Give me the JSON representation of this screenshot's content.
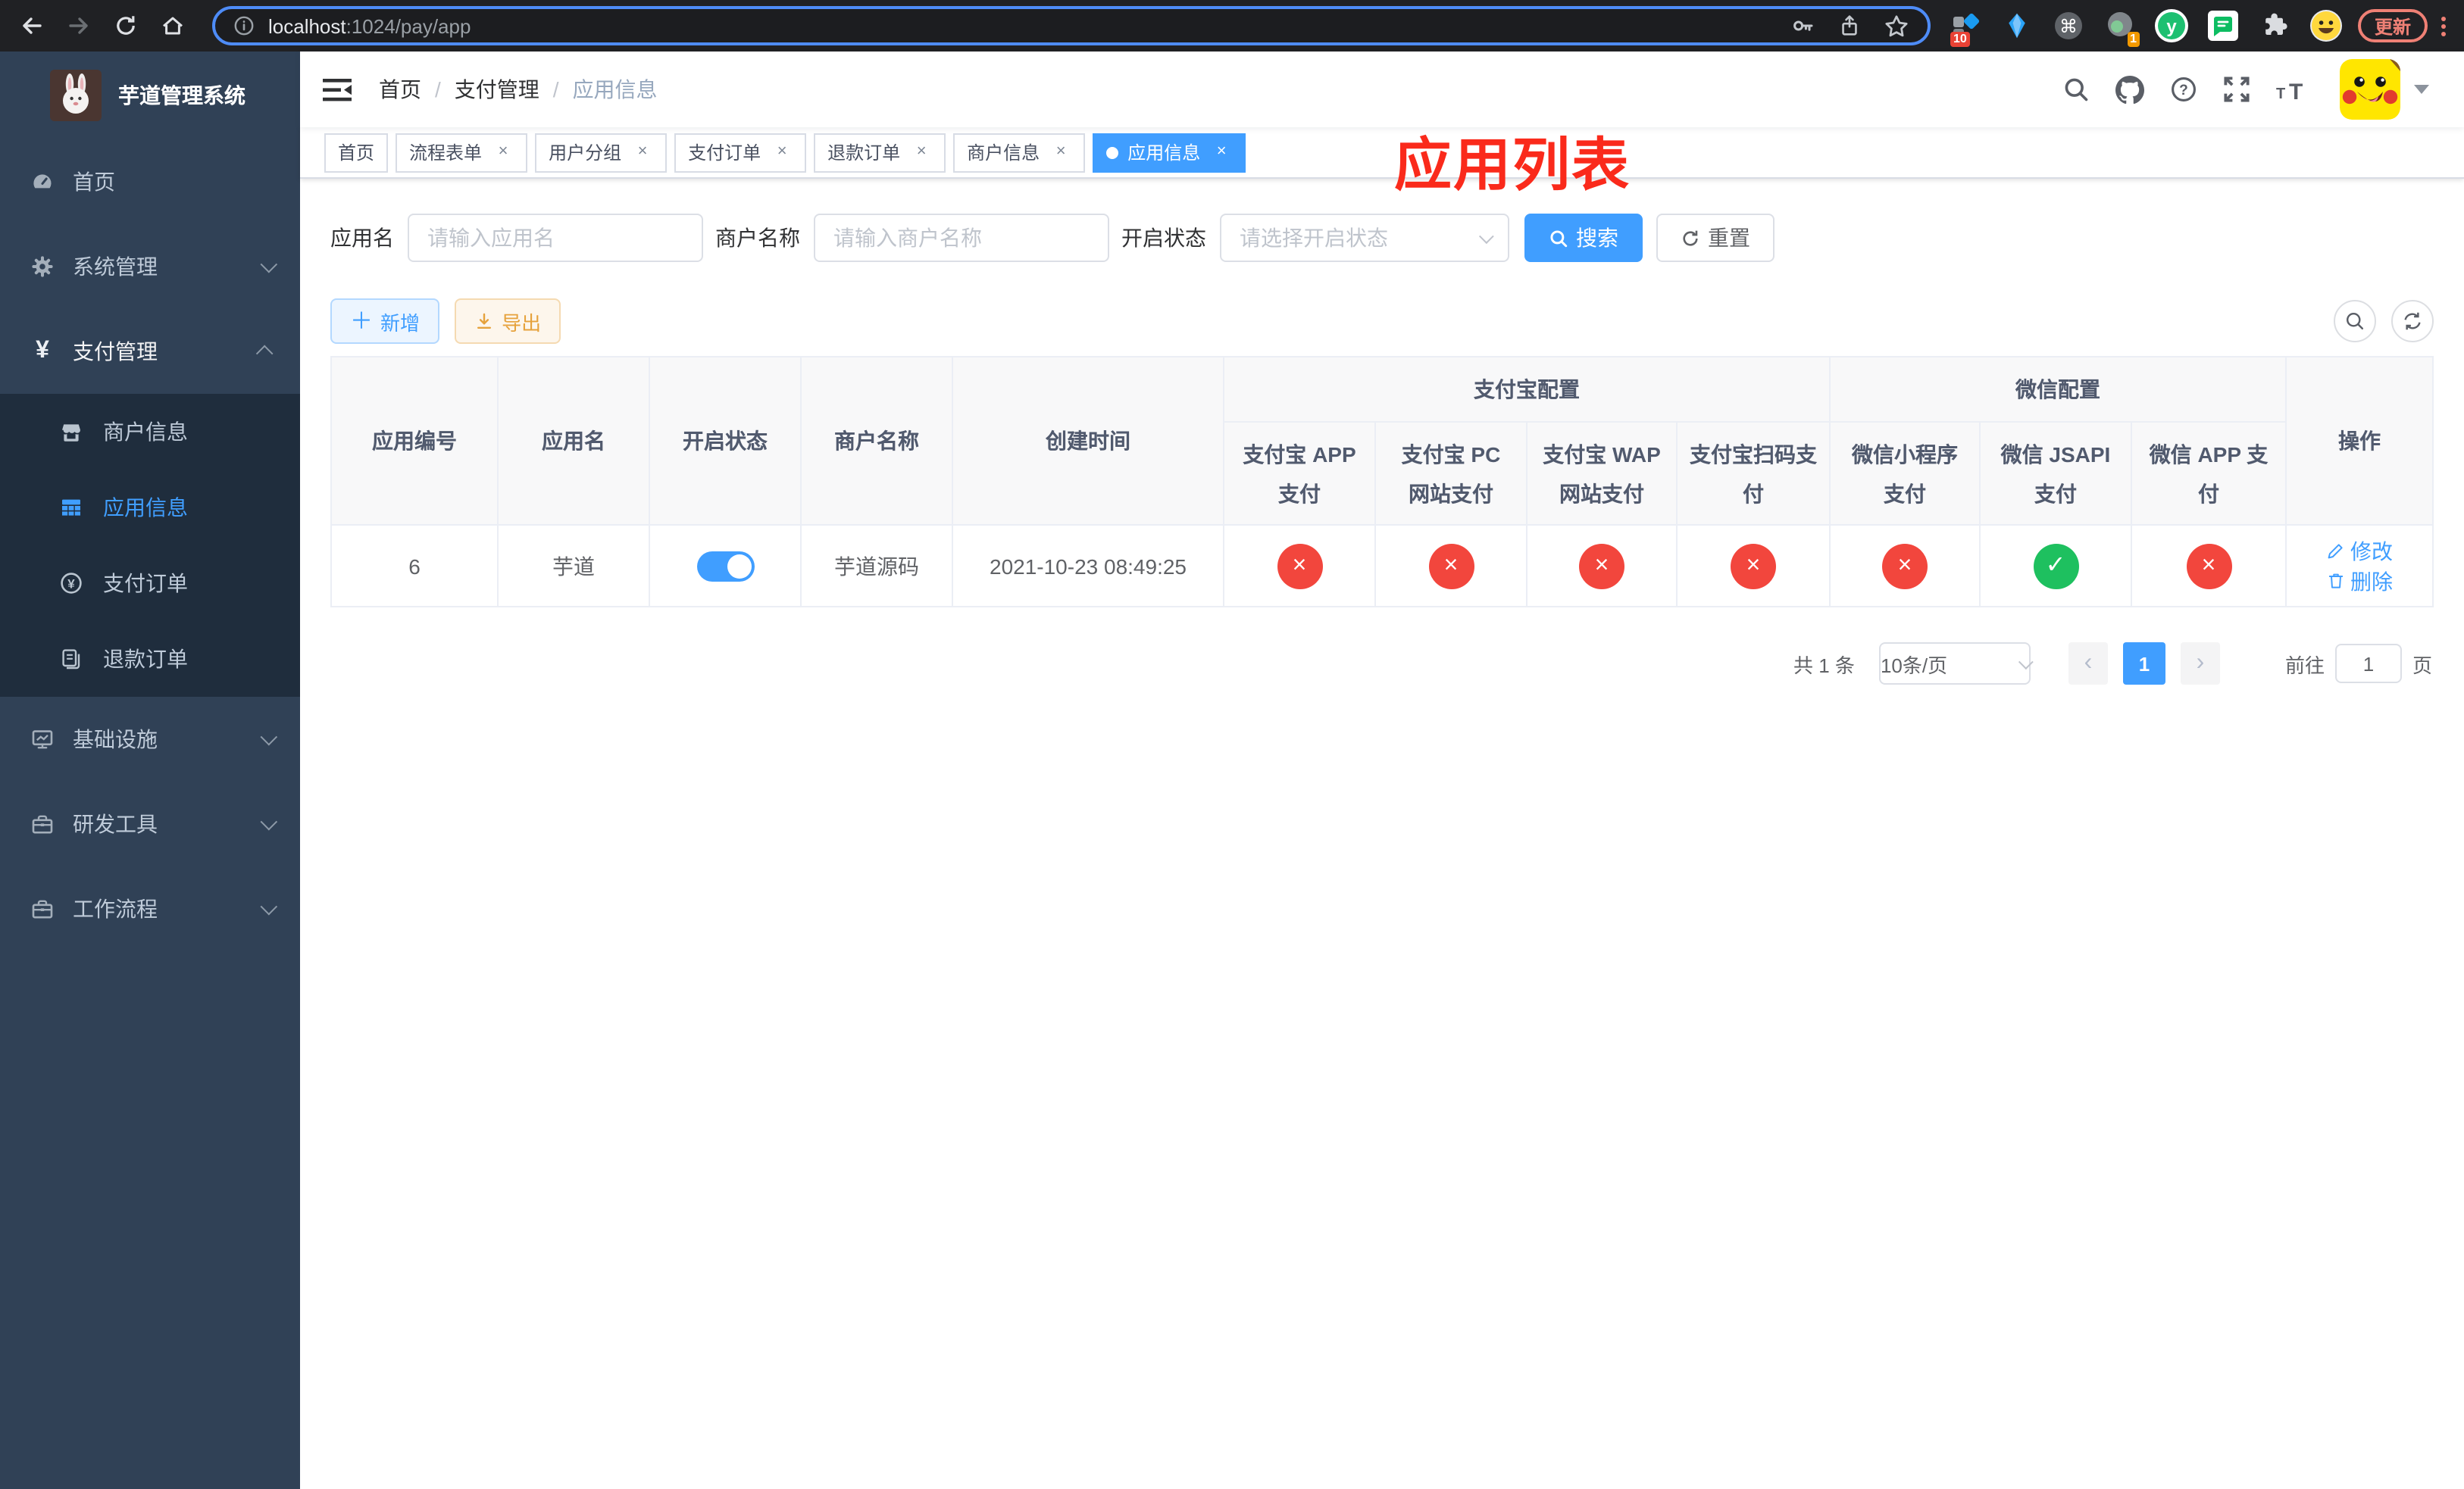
{
  "colors": {
    "primary": "#409eff",
    "success": "#1ec05f",
    "danger": "#f2463d",
    "warning": "#e6a23c",
    "sidebar_bg": "#304156",
    "submenu_bg": "#1f2d3d",
    "annotation_red": "#fa2a1b",
    "tag_active": "#409eff"
  },
  "browser": {
    "url_host": "localhost",
    "url_rest": ":1024/pay/app",
    "update_label": "更新",
    "ext_badge_a": "10",
    "ext_badge_b": "1"
  },
  "sidebar": {
    "title": "芋道管理系统",
    "menu": [
      {
        "label": "首页"
      },
      {
        "label": "系统管理"
      },
      {
        "label": "支付管理"
      },
      {
        "label": "基础设施"
      },
      {
        "label": "研发工具"
      },
      {
        "label": "工作流程"
      }
    ],
    "submenu": [
      {
        "label": "商户信息"
      },
      {
        "label": "应用信息"
      },
      {
        "label": "支付订单"
      },
      {
        "label": "退款订单"
      }
    ]
  },
  "header": {
    "breadcrumb": [
      "首页",
      "支付管理",
      "应用信息"
    ],
    "separator": "/",
    "annotation": "应用列表"
  },
  "tabs": [
    {
      "label": "首页"
    },
    {
      "label": "流程表单"
    },
    {
      "label": "用户分组"
    },
    {
      "label": "支付订单"
    },
    {
      "label": "退款订单"
    },
    {
      "label": "商户信息"
    },
    {
      "label": "应用信息"
    }
  ],
  "search": {
    "app_label": "应用名",
    "app_placeholder": "请输入应用名",
    "merchant_label": "商户名称",
    "merchant_placeholder": "请输入商户名称",
    "status_label": "开启状态",
    "status_placeholder": "请选择开启状态",
    "search_btn": "搜索",
    "reset_btn": "重置"
  },
  "toolbar": {
    "add_btn": "新增",
    "export_btn": "导出"
  },
  "table": {
    "cols": [
      "应用编号",
      "应用名",
      "开启状态",
      "商户名称",
      "创建时间"
    ],
    "group_alipay": "支付宝配置",
    "group_wechat": "微信配置",
    "sub_cols": [
      "支付宝 APP 支付",
      "支付宝 PC 网站支付",
      "支付宝 WAP 网站支付",
      "支付宝扫码支付",
      "微信小程序支付",
      "微信 JSAPI 支付",
      "微信 APP 支付"
    ],
    "op_col": "操作",
    "row": {
      "id": "6",
      "name": "芋道",
      "merchant": "芋道源码",
      "created": "2021-10-23 08:49:25",
      "statuses": [
        {
          "glyph": "×",
          "style": "background:#f2463d"
        },
        {
          "glyph": "×",
          "style": "background:#f2463d"
        },
        {
          "glyph": "×",
          "style": "background:#f2463d"
        },
        {
          "glyph": "×",
          "style": "background:#f2463d"
        },
        {
          "glyph": "×",
          "style": "background:#f2463d"
        },
        {
          "glyph": "✓",
          "style": "background:#1ec05f"
        },
        {
          "glyph": "×",
          "style": "background:#f2463d"
        }
      ],
      "edit": "修改",
      "delete": "删除"
    }
  },
  "pagination": {
    "total": "共 1 条",
    "page_size": "10条/页",
    "page": "1",
    "goto": "前往",
    "goto_value": "1",
    "unit": "页"
  }
}
